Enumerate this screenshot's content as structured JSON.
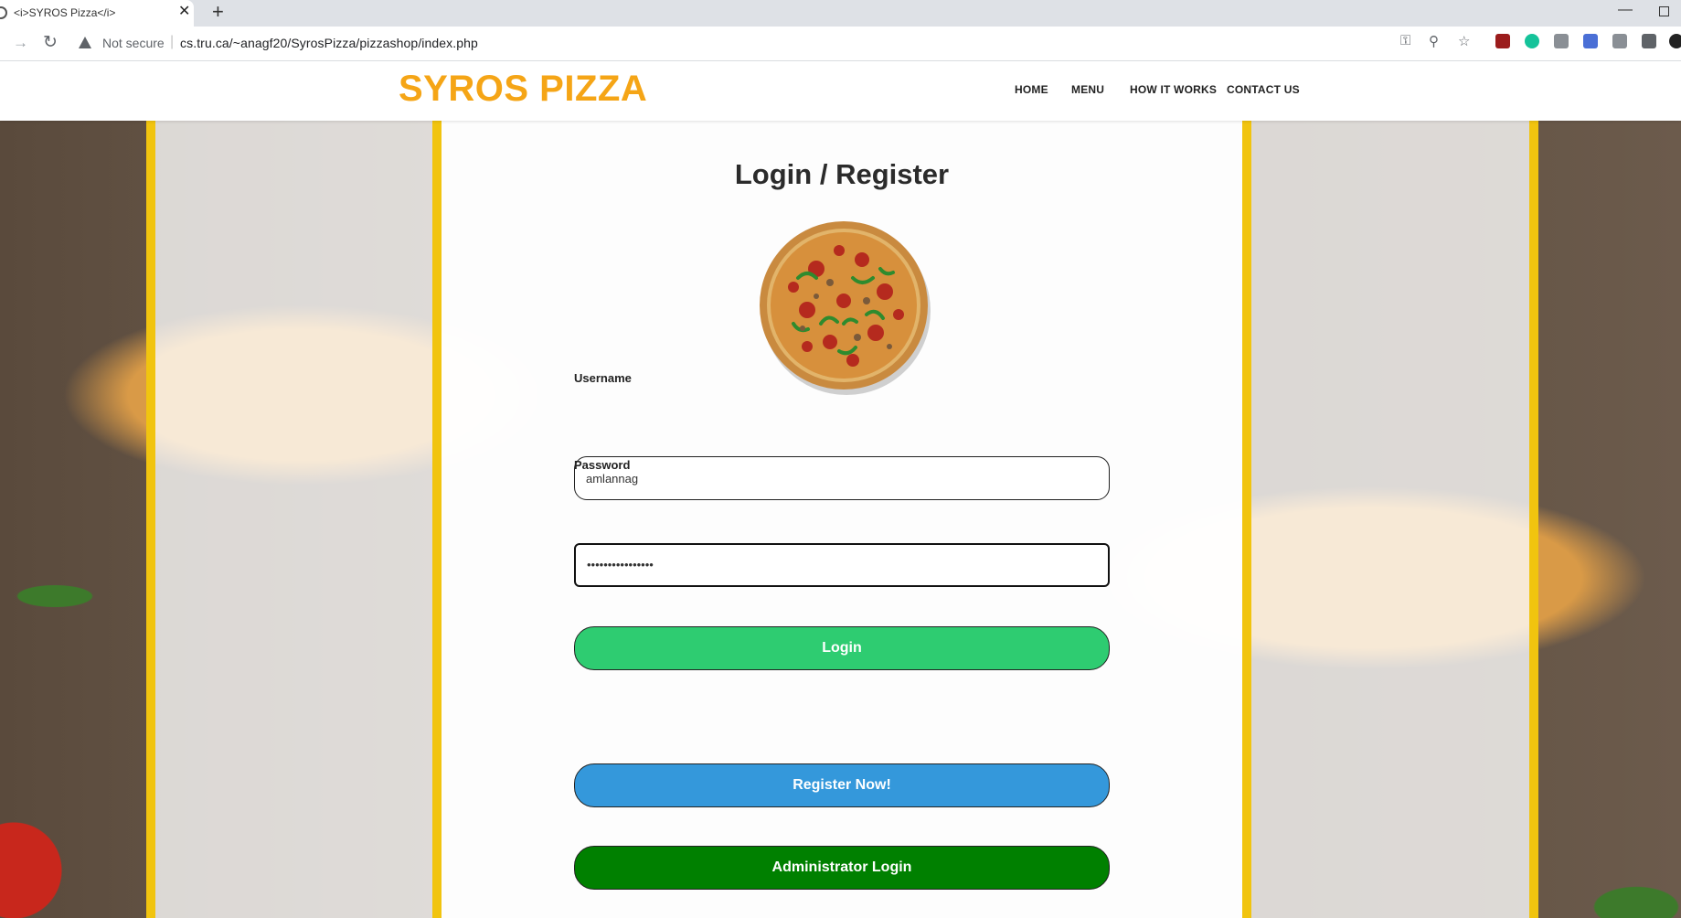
{
  "browser": {
    "tab_title": "<i>SYROS Pizza</i>",
    "tab_close": "✕",
    "new_tab": "+",
    "security_label": "Not secure",
    "url": "cs.tru.ca/~anagf20/SyrosPizza/pizzashop/index.php"
  },
  "header": {
    "brand": "SYROS PIZZA",
    "nav": [
      "HOME",
      "MENU",
      "HOW IT WORKS",
      "CONTACT US"
    ]
  },
  "login": {
    "title": "Login / Register",
    "username_label": "Username",
    "username_value": "amlannag",
    "password_label": "Password",
    "password_value": "••••••••••••••••",
    "login_button": "Login",
    "register_button": "Register Now!",
    "admin_button": "Administrator Login"
  },
  "colors": {
    "brand": "#f5a516",
    "side_bars": "#f1c40f",
    "login_button": "#2ecc71",
    "register_button": "#3498db",
    "admin_button": "#008000"
  }
}
